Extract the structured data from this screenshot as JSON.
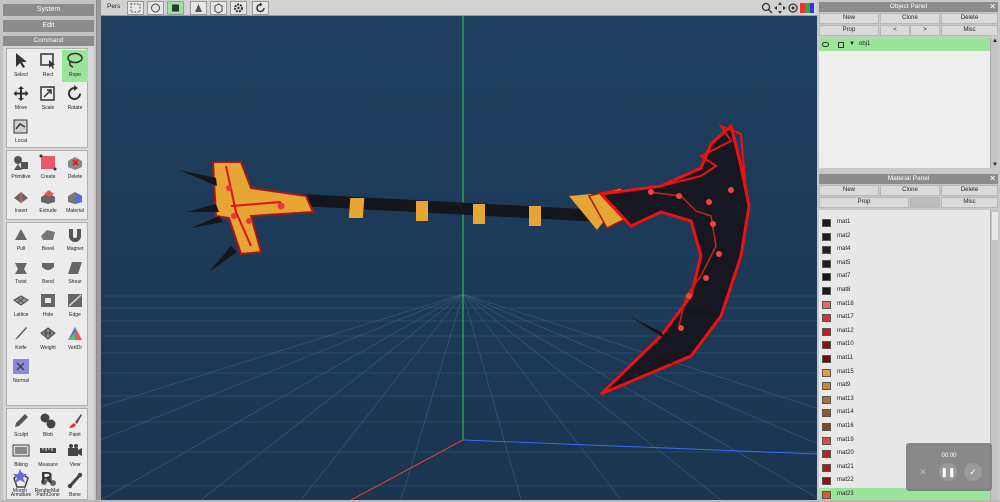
{
  "left": {
    "system": "System",
    "edit": "Edit",
    "command": "Command",
    "tools": {
      "select": "Select",
      "rect": "Rect",
      "rope": "Rope",
      "move": "Move",
      "scale": "Scale",
      "rotate": "Rotate",
      "local": "Local",
      "primitive": "Primitive",
      "create": "Create",
      "delete": "Delete",
      "insert": "Insert",
      "extrude": "Extrude",
      "material": "Material",
      "pull": "Pull",
      "bevel": "Bevel",
      "magnet": "Magnet",
      "twist": "Twist",
      "bend": "Bend",
      "shear": "Shear",
      "lattice": "Lattice",
      "hole": "Hole",
      "edge": "Edge",
      "knife": "Knife",
      "weight": "Weight",
      "vertdr": "VertDr",
      "normal": "Normal",
      "sculpt": "Sculpt",
      "blob": "Blob",
      "paint": "Paint",
      "biking": "Biking",
      "measure": "Measure",
      "view": "View",
      "armature": "Armature",
      "pathclone": "PathClone",
      "bone": "Bone",
      "morph": "Morph",
      "rendermat": "RenderMat"
    }
  },
  "toolbar": {
    "pers": "Pers"
  },
  "object_panel": {
    "title": "Object Panel",
    "new": "New",
    "clone": "Clone",
    "delete": "Delete",
    "prop": "Prop",
    "prev": "<",
    "next": ">",
    "misc": "Misc",
    "object_name": "obj1"
  },
  "material_panel": {
    "title": "Material Panel",
    "new": "New",
    "clone": "Clone",
    "delete": "Delete",
    "prop": "Prop",
    "misc": "Misc",
    "materials": [
      {
        "name": "mat1",
        "color": "#1a1a1a"
      },
      {
        "name": "mat2",
        "color": "#1c1c1c"
      },
      {
        "name": "mat4",
        "color": "#222222"
      },
      {
        "name": "mat5",
        "color": "#1e1e1e"
      },
      {
        "name": "mat7",
        "color": "#161616"
      },
      {
        "name": "mat8",
        "color": "#1a1a1a"
      },
      {
        "name": "mat18",
        "color": "#e86868"
      },
      {
        "name": "mat17",
        "color": "#d93030"
      },
      {
        "name": "mat12",
        "color": "#cc1a1a"
      },
      {
        "name": "mat10",
        "color": "#8c1010"
      },
      {
        "name": "mat11",
        "color": "#6e0c0c"
      },
      {
        "name": "mat15",
        "color": "#e0a040"
      },
      {
        "name": "mat9",
        "color": "#c88a30"
      },
      {
        "name": "mat13",
        "color": "#a87028"
      },
      {
        "name": "mat14",
        "color": "#8c5c24"
      },
      {
        "name": "mat16",
        "color": "#7a4e20"
      },
      {
        "name": "mat19",
        "color": "#e04848"
      },
      {
        "name": "mat20",
        "color": "#c42020"
      },
      {
        "name": "mat21",
        "color": "#b01818"
      },
      {
        "name": "mat22",
        "color": "#901212"
      },
      {
        "name": "mat23",
        "color": "#e05a20"
      }
    ]
  },
  "recording": {
    "time": "00:00"
  }
}
